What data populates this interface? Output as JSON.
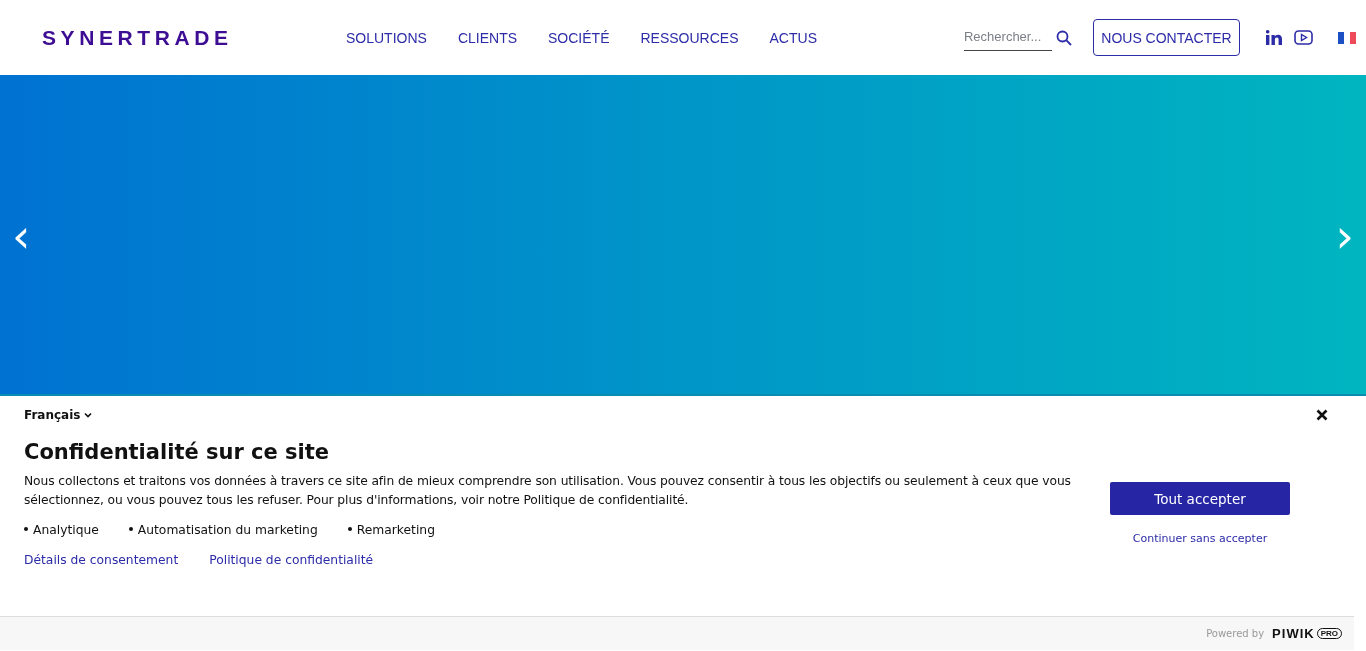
{
  "header": {
    "logo": "SYNERTRADE",
    "nav": [
      {
        "label": "SOLUTIONS"
      },
      {
        "label": "CLIENTS"
      },
      {
        "label": "SOCIÉTÉ"
      },
      {
        "label": "RESSOURCES"
      },
      {
        "label": "ACTUS"
      }
    ],
    "search": {
      "placeholder": "Rechercher..."
    },
    "contact_button": "NOUS CONTACTER"
  },
  "hero": {
    "prev": "‹",
    "next": "›"
  },
  "consent": {
    "language": "Français",
    "title": "Confidentialité sur ce site",
    "text": "Nous collectons et traitons vos données à travers ce site afin de mieux comprendre son utilisation. Vous pouvez consentir à tous les objectifs ou seulement à ceux que vous sélectionnez, ou vous pouvez tous les refuser. Pour plus d'informations, voir notre Politique de confidentialité.",
    "purposes": [
      "Analytique",
      "Automatisation du marketing",
      "Remarketing"
    ],
    "links": [
      "Détails de consentement",
      "Politique de confidentialité"
    ],
    "accept_button": "Tout accepter",
    "continue_link": "Continuer sans accepter"
  },
  "footer": {
    "powered_by": "Powered by",
    "brand": "PIWIK",
    "brand_badge": "PRO"
  }
}
